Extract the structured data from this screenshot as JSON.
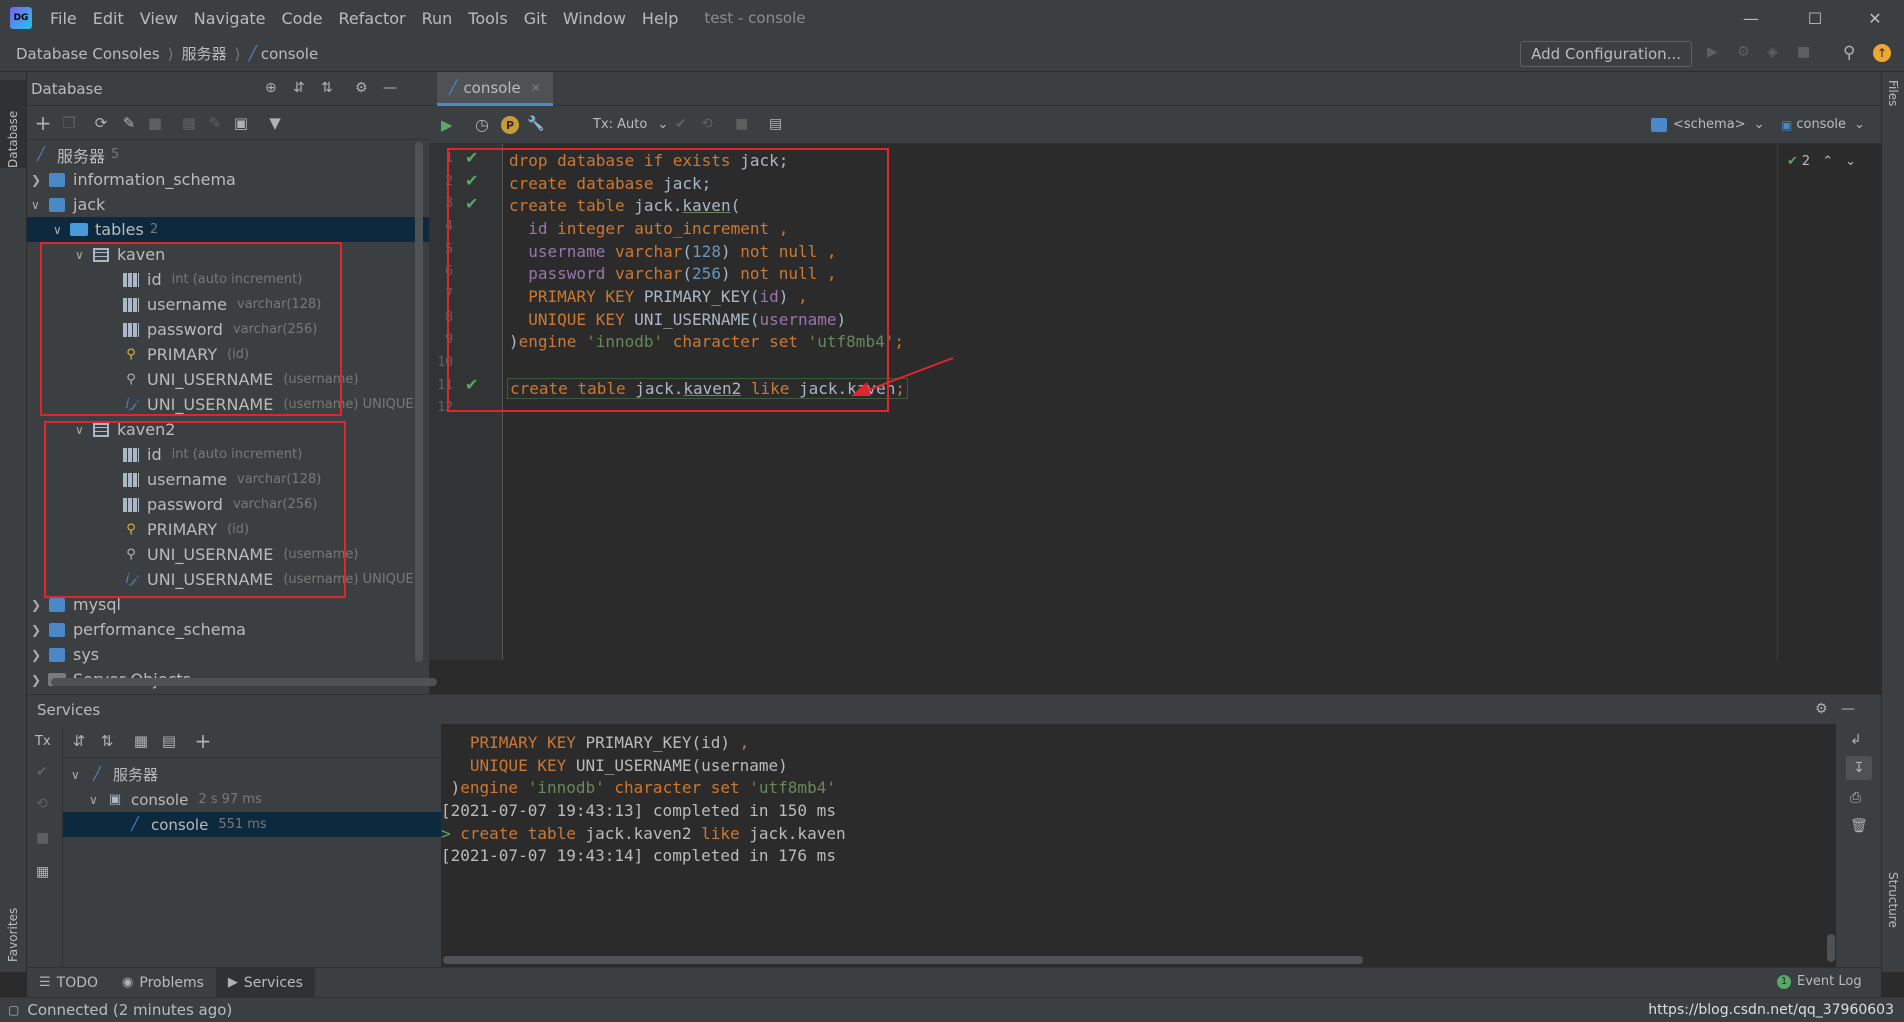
{
  "window": {
    "menu": [
      "File",
      "Edit",
      "View",
      "Navigate",
      "Code",
      "Refactor",
      "Run",
      "Tools",
      "Git",
      "Window",
      "Help"
    ],
    "title": "test - console"
  },
  "breadcrumb": [
    "Database Consoles",
    "服务器",
    "console"
  ],
  "run_config": {
    "label": "Add Configuration..."
  },
  "left_stripe": {
    "database_label": "Database",
    "favorites_label": "Favorites"
  },
  "right_stripe": {
    "files_label": "Files",
    "structure_label": "Structure"
  },
  "database_panel": {
    "title": "Database",
    "root": {
      "label": "服务器",
      "count": "5"
    },
    "schemas": [
      "information_schema",
      "jack",
      "mysql",
      "performance_schema",
      "sys"
    ],
    "tables_folder": {
      "label": "tables",
      "count": "2"
    },
    "tables": [
      {
        "name": "kaven",
        "items": [
          {
            "name": "id",
            "hint": "int (auto increment)",
            "kind": "column-key"
          },
          {
            "name": "username",
            "hint": "varchar(128)",
            "kind": "column"
          },
          {
            "name": "password",
            "hint": "varchar(256)",
            "kind": "column"
          },
          {
            "name": "PRIMARY",
            "hint": "(id)",
            "kind": "key"
          },
          {
            "name": "UNI_USERNAME",
            "hint": "(username)",
            "kind": "index"
          },
          {
            "name": "UNI_USERNAME",
            "hint": "(username) UNIQUE",
            "kind": "unique"
          }
        ]
      },
      {
        "name": "kaven2",
        "items": [
          {
            "name": "id",
            "hint": "int (auto increment)",
            "kind": "column-key"
          },
          {
            "name": "username",
            "hint": "varchar(128)",
            "kind": "column"
          },
          {
            "name": "password",
            "hint": "varchar(256)",
            "kind": "column"
          },
          {
            "name": "PRIMARY",
            "hint": "(id)",
            "kind": "key"
          },
          {
            "name": "UNI_USERNAME",
            "hint": "(username)",
            "kind": "index"
          },
          {
            "name": "UNI_USERNAME",
            "hint": "(username) UNIQUE",
            "kind": "unique"
          }
        ]
      }
    ],
    "server_objects": "Server Objects"
  },
  "editor": {
    "tab": "console",
    "tx_mode": "Tx: Auto",
    "schema_selector": "<schema>",
    "console_selector": "console",
    "inspection_count": "2",
    "line_numbers": [
      "1",
      "2",
      "3",
      "4",
      "5",
      "6",
      "7",
      "8",
      "9",
      "10",
      "11",
      "12"
    ]
  },
  "services": {
    "title": "Services",
    "tx_label": "Tx",
    "tree": {
      "root": "服务器",
      "session": {
        "label": "console",
        "time": "2 s 97 ms"
      },
      "child": {
        "label": "console",
        "time": "551 ms"
      }
    },
    "output": [
      "   PRIMARY KEY PRIMARY_KEY(id) ,",
      "   UNIQUE KEY UNI_USERNAME(username)",
      " )engine 'innodb' character set 'utf8mb4'",
      "[2021-07-07 19:43:13] completed in 150 ms",
      "> create table jack.kaven2 like jack.kaven",
      "[2021-07-07 19:43:14] completed in 176 ms"
    ]
  },
  "tool_tabs": [
    "TODO",
    "Problems",
    "Services"
  ],
  "event_log": "Event Log",
  "status": {
    "text": "Connected (2 minutes ago)",
    "watermark": "https://blog.csdn.net/qq_37960603"
  },
  "colors": {
    "highlight": "#e0262a",
    "selection": "#0d293e",
    "ok": "#59a869"
  }
}
